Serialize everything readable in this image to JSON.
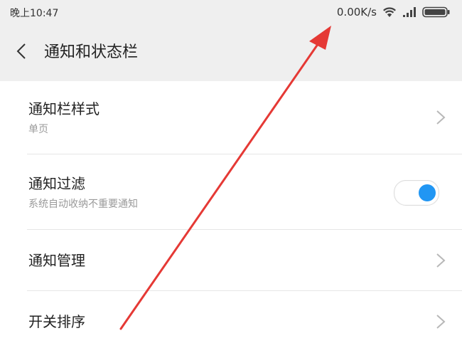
{
  "status_bar": {
    "time": "晚上10:47",
    "net_speed": "0.00K/s",
    "icons": [
      "wifi-icon",
      "signal-icon",
      "battery-icon"
    ]
  },
  "header": {
    "back_icon": "chevron-left-icon",
    "title": "通知和状态栏"
  },
  "settings": {
    "items": [
      {
        "title": "通知栏样式",
        "subtitle": "单页",
        "control": "chevron"
      },
      {
        "title": "通知过滤",
        "subtitle": "系统自动收纳不重要通知",
        "control": "toggle",
        "toggle_on": true
      },
      {
        "title": "通知管理",
        "control": "chevron"
      },
      {
        "title": "开关排序",
        "control": "chevron"
      }
    ]
  },
  "colors": {
    "toggle_accent": "#2196f3",
    "annotation_arrow": "#e53935",
    "header_bg": "#efefef"
  }
}
